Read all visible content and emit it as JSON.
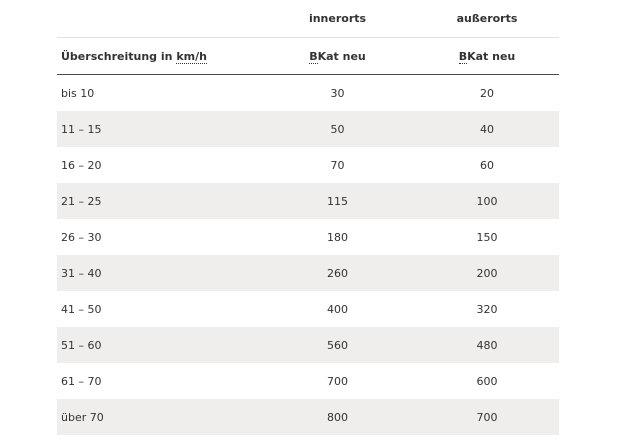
{
  "header": {
    "col2_top": "innerorts",
    "col3_top": "außerorts",
    "col1_prefix": "Überschreitung in ",
    "col1_unit": "km/h",
    "col2_abbr": "B",
    "col2_rest": "Kat neu",
    "col3_abbr": "B",
    "col3_rest": "Kat neu"
  },
  "rows": [
    {
      "range": "bis 10",
      "innerorts": "30",
      "ausserorts": "20"
    },
    {
      "range": "11 – 15",
      "innerorts": "50",
      "ausserorts": "40"
    },
    {
      "range": "16 – 20",
      "innerorts": "70",
      "ausserorts": "60"
    },
    {
      "range": "21 – 25",
      "innerorts": "115",
      "ausserorts": "100"
    },
    {
      "range": "26 – 30",
      "innerorts": "180",
      "ausserorts": "150"
    },
    {
      "range": "31 – 40",
      "innerorts": "260",
      "ausserorts": "200"
    },
    {
      "range": "41 – 50",
      "innerorts": "400",
      "ausserorts": "320"
    },
    {
      "range": "51 – 60",
      "innerorts": "560",
      "ausserorts": "480"
    },
    {
      "range": "61 – 70",
      "innerorts": "700",
      "ausserorts": "600"
    },
    {
      "range": "über 70",
      "innerorts": "800",
      "ausserorts": "700"
    }
  ]
}
